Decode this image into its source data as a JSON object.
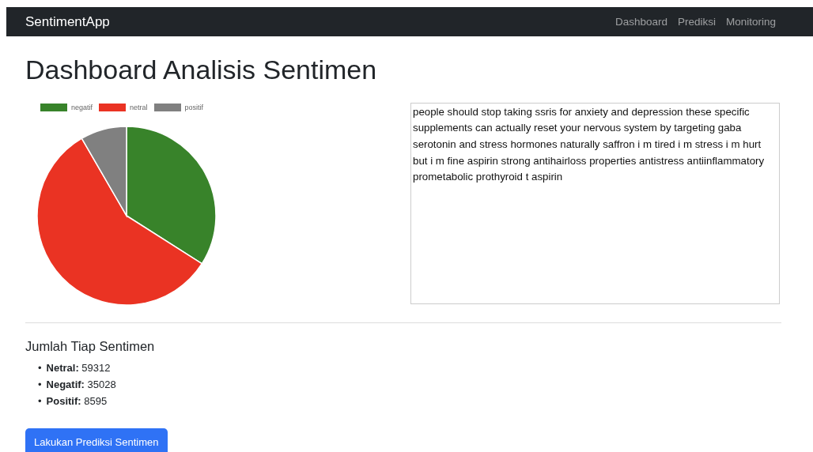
{
  "navbar": {
    "brand": "SentimentApp",
    "links": [
      {
        "label": "Dashboard",
        "selected": false
      },
      {
        "label": "Prediksi",
        "selected": false
      },
      {
        "label": "Monitoring",
        "selected": false
      }
    ]
  },
  "title": "Dashboard Analisis Sentimen",
  "chart_data": {
    "type": "pie",
    "legend": "top",
    "categories": [
      "negatif",
      "netral",
      "positif"
    ],
    "colors": [
      "#38832a",
      "#ea3323",
      "#808080"
    ],
    "values": [
      34.03,
      57.62,
      8.35
    ]
  },
  "text_box": {
    "value": "people should stop taking ssris for anxiety and depression these specific supplements can actually reset your nervous system by targeting gaba serotonin and stress hormones naturally saffron i m tired i m stress i m hurt but i m fine aspirin strong antihairloss properties antistress antiinflammatory prometabolic prothyroid t aspirin"
  },
  "counts": {
    "heading": "Jumlah Tiap Sentimen",
    "items": [
      {
        "marker": "•",
        "text": "**Netral:** 59312"
      },
      {
        "marker": "•",
        "text": "**Negatif:** 35028"
      },
      {
        "marker": "•",
        "text": "**Positif:** 8595"
      }
    ]
  },
  "button": "Lakukan Prediksi Sentimen"
}
